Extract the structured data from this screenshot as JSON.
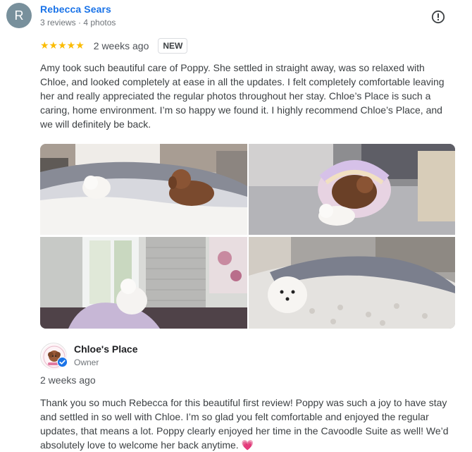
{
  "review": {
    "avatar_letter": "R",
    "reviewer_name": "Rebecca Sears",
    "reviewer_meta": "3 reviews · 4 photos",
    "flag_icon": "report-flag-icon",
    "stars": "★★★★★",
    "rating": 5,
    "time": "2 weeks ago",
    "badge": "NEW",
    "text": "Amy took such beautiful care of Poppy. She settled in straight away, was so relaxed with Chloe, and looked completely at ease in all the updates. I felt completely comfortable leaving her and really appreciated the regular photos throughout her stay. Chloe’s Place is such a caring, home environment. I’m so happy we found it. I highly recommend Chloe’s Place, and we will definitely be back.",
    "photos": [
      {
        "name": "dogs-on-bed-photo"
      },
      {
        "name": "dogs-in-pet-bed-photo"
      },
      {
        "name": "dog-at-window-photo"
      },
      {
        "name": "dog-under-blanket-photo"
      }
    ]
  },
  "owner_reply": {
    "name": "Chloe's Place",
    "role": "Owner",
    "time": "2 weeks ago",
    "text": "Thank you so much Rebecca for this beautiful first review! Poppy was such a joy to have stay and settled in so well with Chloe. I’m so glad you felt comfortable and enjoyed the regular updates, that means a lot. Poppy clearly enjoyed her time in the Cavoodle Suite as well! We’d absolutely love to welcome her back anytime.",
    "emoji": "💗"
  },
  "colors": {
    "link_blue": "#1a73e8",
    "star_yellow": "#fbbc04",
    "avatar_grey": "#78909c",
    "verified_blue": "#1a73e8"
  }
}
